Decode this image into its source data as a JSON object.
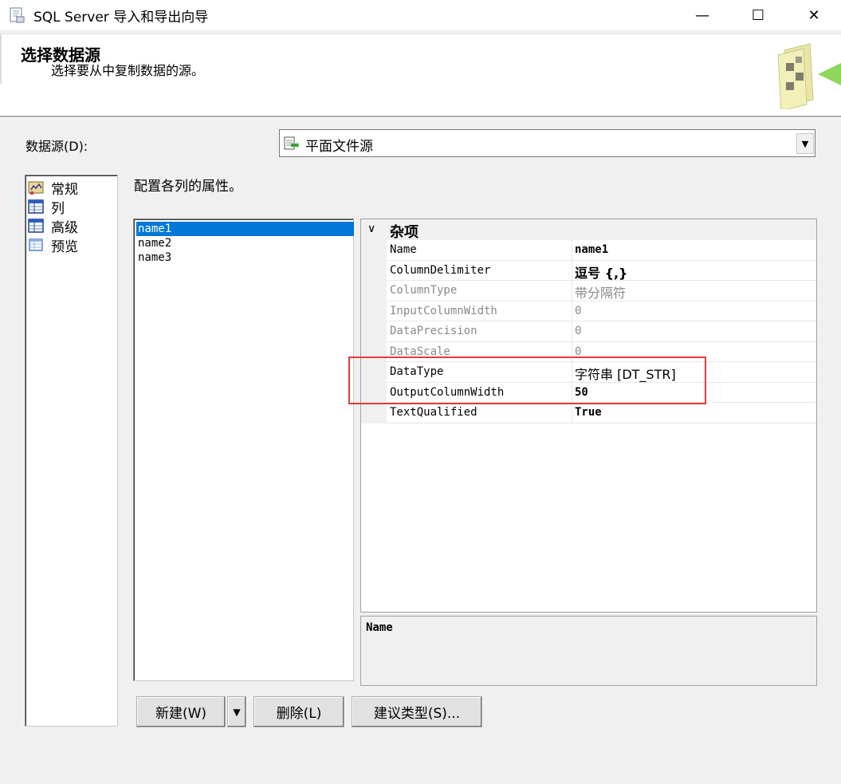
{
  "window": {
    "title": "SQL Server 导入和导出向导",
    "min_glyph": "—",
    "max_glyph": "☐",
    "close_glyph": "✕"
  },
  "header": {
    "title": "选择数据源",
    "subtitle": "选择要从中复制数据的源。"
  },
  "data_source": {
    "label": "数据源(D):",
    "value": "平面文件源",
    "arrow_glyph": "▼"
  },
  "nav": {
    "items": [
      {
        "label": "常规",
        "icon": "general-icon"
      },
      {
        "label": "列",
        "icon": "columns-icon"
      },
      {
        "label": "高级",
        "icon": "advanced-icon"
      },
      {
        "label": "预览",
        "icon": "preview-icon"
      }
    ]
  },
  "main": {
    "instruction": "配置各列的属性。"
  },
  "columns": {
    "items": [
      "name1",
      "name2",
      "name3"
    ],
    "selected_index": 0
  },
  "properties": {
    "category_chevron": "∨",
    "category": "杂项",
    "rows": [
      {
        "name": "Name",
        "value": "name1"
      },
      {
        "name": "ColumnDelimiter",
        "value": "逗号 {,}"
      },
      {
        "name": "ColumnType",
        "value": "带分隔符"
      },
      {
        "name": "InputColumnWidth",
        "value": "0"
      },
      {
        "name": "DataPrecision",
        "value": "0"
      },
      {
        "name": "DataScale",
        "value": "0"
      },
      {
        "name": "DataType",
        "value": "字符串 [DT_STR]"
      },
      {
        "name": "OutputColumnWidth",
        "value": "50"
      },
      {
        "name": "TextQualified",
        "value": "True"
      }
    ]
  },
  "description": {
    "title": "Name"
  },
  "buttons": {
    "new_label": "新建(W)",
    "new_drop_glyph": "▼",
    "delete_label": "删除(L)",
    "suggest_label": "建议类型(S)..."
  },
  "colors": {
    "selection": "#0078d7",
    "highlight_border": "#e03c3c",
    "dialog_bg": "#f0f0f0"
  }
}
